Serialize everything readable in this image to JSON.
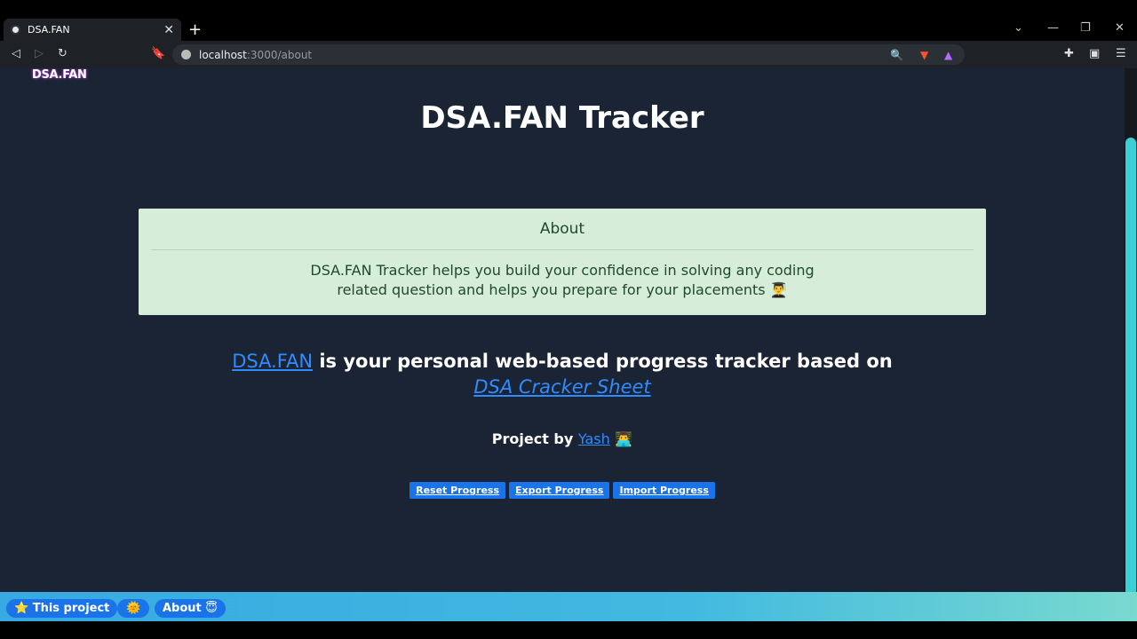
{
  "browser": {
    "tab_title": "DSA.FAN",
    "url_host": "localhost",
    "url_path": ":3000/about"
  },
  "page": {
    "logo": "DSA.FAN",
    "title": "DSA.FAN Tracker",
    "about": {
      "heading": "About",
      "body": "DSA.FAN Tracker helps you build your confidence in solving any coding related question and helps you prepare for your placements 👨‍🎓"
    },
    "tagline": {
      "link_text": "DSA.FAN",
      "middle": "is your personal web-based progress tracker based on",
      "sheet_link": "DSA Cracker Sheet"
    },
    "project_by": {
      "prefix": "Project by",
      "author": "Yash",
      "emoji": "👨‍💻"
    },
    "buttons": {
      "reset": "Reset Progress",
      "export": "Export Progress",
      "import": "Import Progress"
    }
  },
  "bottom_bar": {
    "this_project": "⭐ This project",
    "theme_toggle": "🌞",
    "about": "About 😇"
  },
  "colors": {
    "page_bg": "#1b2434",
    "link": "#2f8cff",
    "button": "#1a73e8",
    "card": "#d6eed9"
  }
}
